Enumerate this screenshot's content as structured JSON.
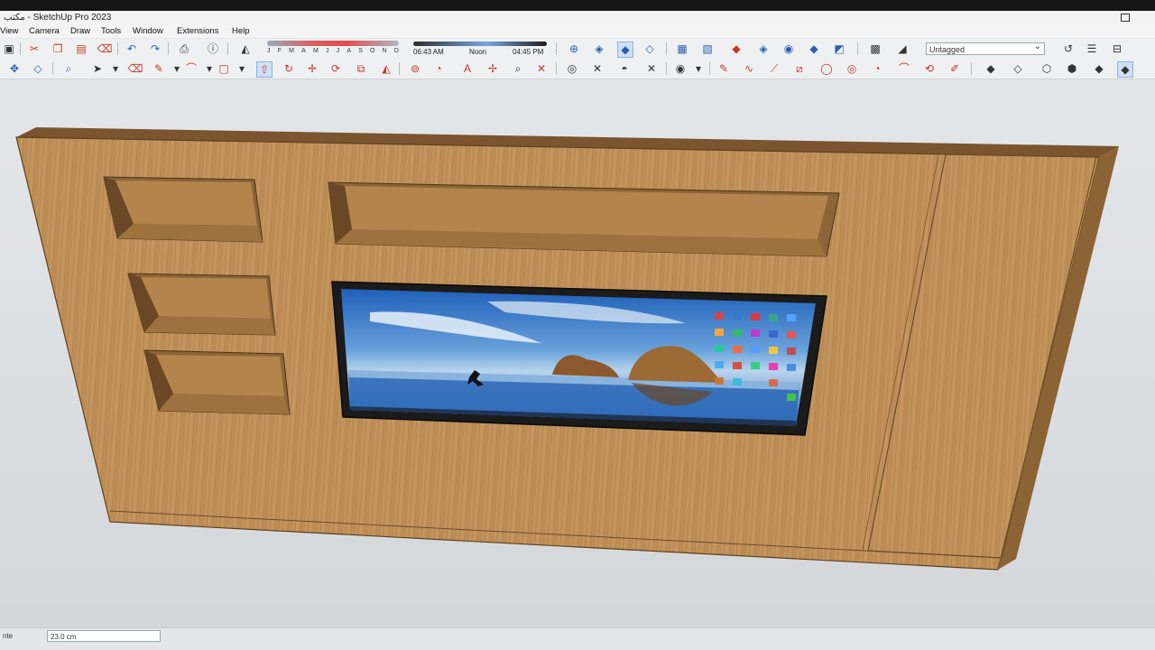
{
  "app": {
    "title": "مكتب - SketchUp Pro 2023",
    "tag_selector": "Untagged"
  },
  "menu": {
    "items": [
      "View",
      "Camera",
      "Draw",
      "Tools",
      "Window",
      "Extensions",
      "Help"
    ]
  },
  "shadow": {
    "months": [
      "J",
      "F",
      "M",
      "A",
      "M",
      "J",
      "J",
      "A",
      "S",
      "O",
      "N",
      "D"
    ],
    "time_start": "06:43 AM",
    "time_mid": "Noon",
    "time_end": "04:45 PM"
  },
  "status": {
    "label": "nte",
    "measurement": "23.0 cm"
  },
  "colors": {
    "wood": "#b88a52",
    "wood_dark": "#8a6232",
    "wood_edge": "#5e4122",
    "sky": "#3a79c9"
  }
}
